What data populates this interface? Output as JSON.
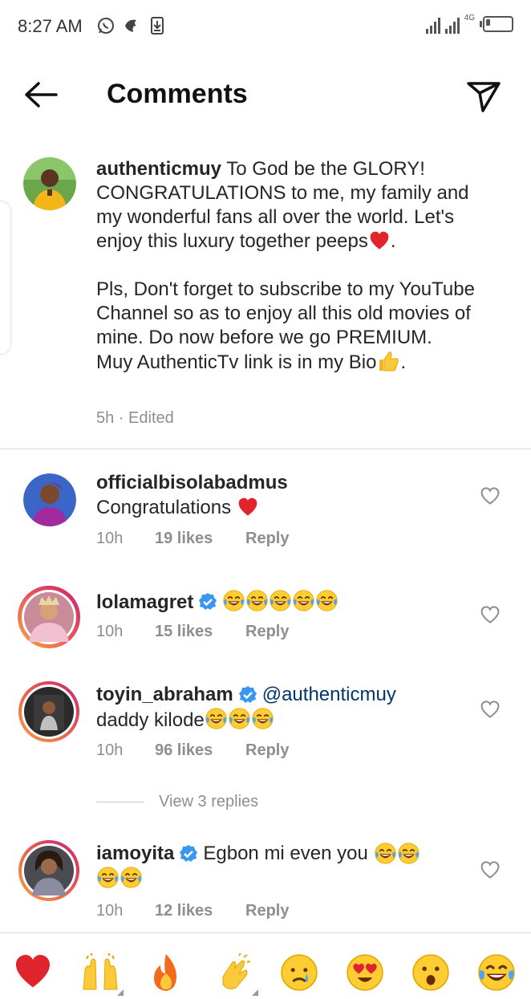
{
  "status_bar": {
    "time": "8:27 AM",
    "network": "4G"
  },
  "header": {
    "title": "Comments"
  },
  "caption": {
    "username": "authenticmuy",
    "line1": "To God be the GLORY! CONGRATULATIONS to me, my family and my wonderful fans all over the world. Let's enjoy this luxury together peeps",
    "line1_end": ".",
    "line2": "Pls, Don't forget to subscribe to my YouTube Channel so as to enjoy all this old movies of mine. Do now before we go PREMIUM.",
    "line3": "Muy AuthenticTv link is in my Bio",
    "line3_end": ".",
    "time": "5h",
    "separator": "·",
    "edited": "Edited"
  },
  "comments": [
    {
      "username": "officialbisolabadmus",
      "text": "Congratulations",
      "time": "10h",
      "likes": "19 likes",
      "reply": "Reply"
    },
    {
      "username": "lolamagret",
      "text": "",
      "time": "10h",
      "likes": "15 likes",
      "reply": "Reply"
    },
    {
      "username": "toyin_abraham",
      "mention": "@authenticmuy",
      "text": "daddy kilode",
      "time": "10h",
      "likes": "96 likes",
      "reply": "Reply"
    },
    {
      "username": "iamoyita",
      "text": "Egbon mi even you",
      "time": "10h",
      "likes": "12 likes",
      "reply": "Reply"
    }
  ],
  "view_replies": "View 3 replies",
  "emoji_bar": [
    "red-heart",
    "raising-hands",
    "fire",
    "clapping-hands",
    "crying-face",
    "heart-eyes-face",
    "surprised-face",
    "tears-of-joy-face"
  ],
  "colors": {
    "link": "#00376b",
    "verified": "#3897f0",
    "muted": "#8e8e8e",
    "heart": "#e0245e"
  }
}
